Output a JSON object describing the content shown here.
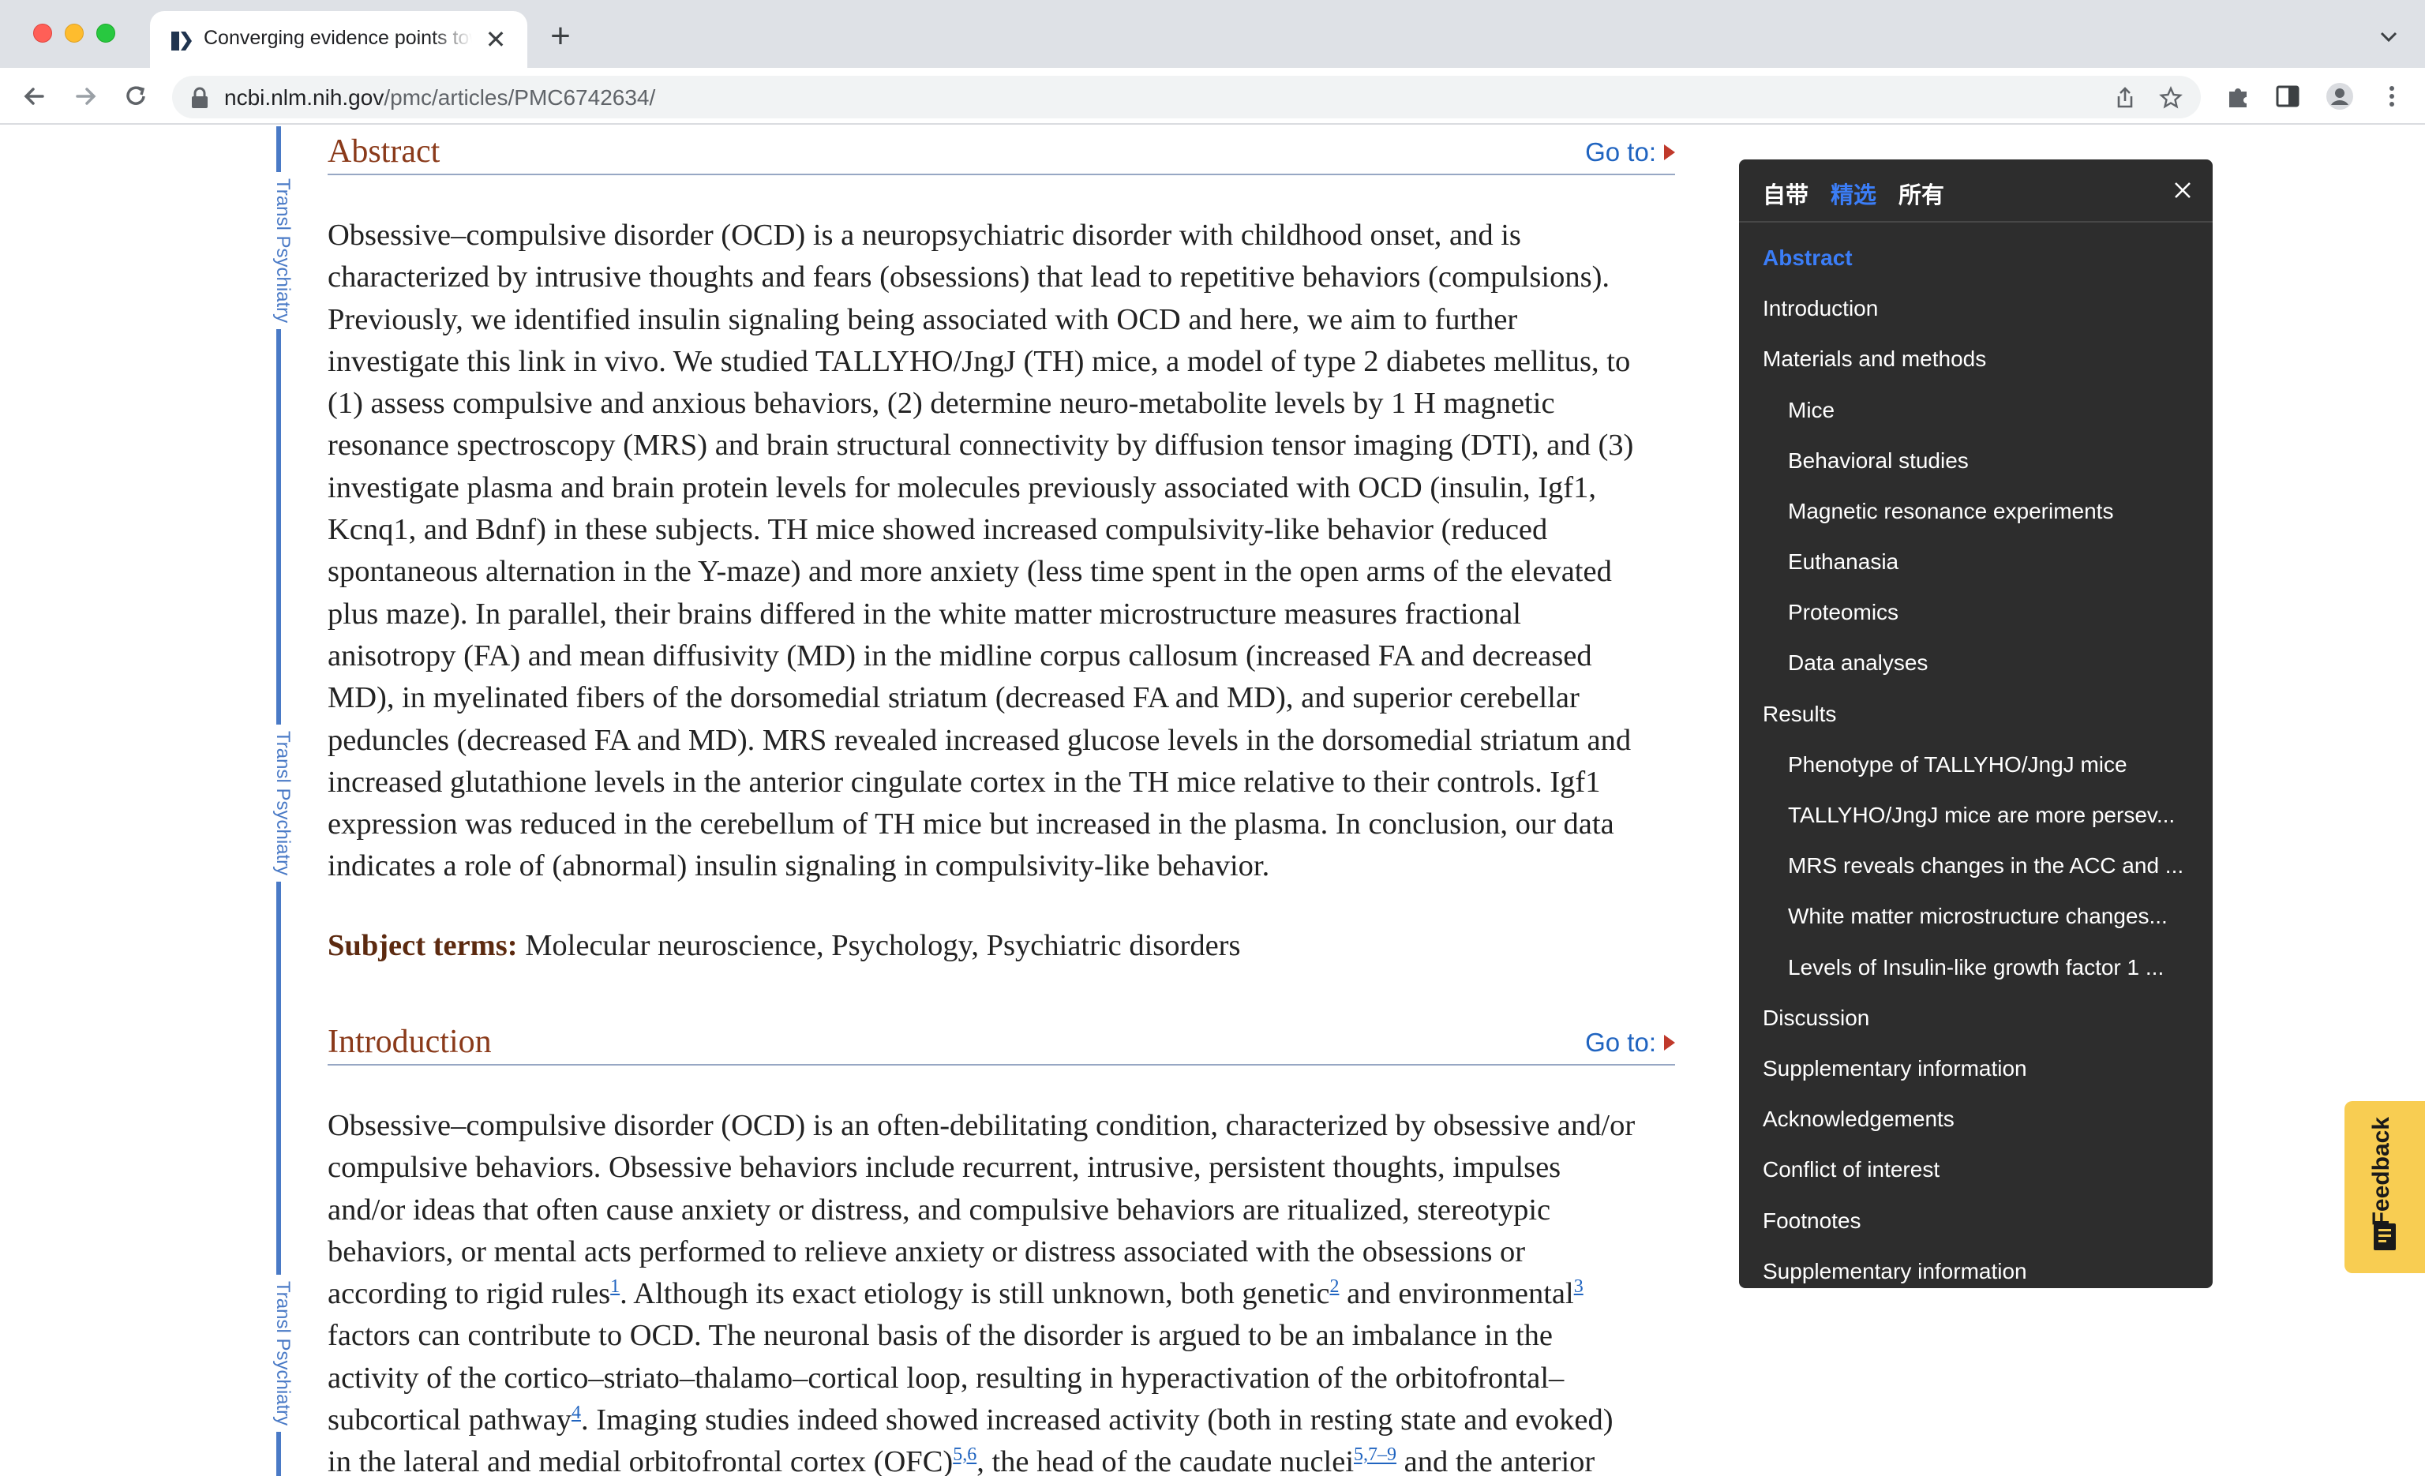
{
  "browser": {
    "tab_title": "Converging evidence points towards a role of insulin signaling",
    "tab_close": "✕",
    "new_tab": "+",
    "url_domain": "ncbi.nlm.nih.gov",
    "url_path": "/pmc/articles/PMC6742634/"
  },
  "page": {
    "journal_label": "Transl Psychiatry",
    "goto_label": "Go to:",
    "abstract": {
      "title": "Abstract",
      "lines": [
        "Obsessive–compulsive disorder (OCD) is a neuropsychiatric disorder with childhood onset, and is",
        "characterized by intrusive thoughts and fears (obsessions) that lead to repetitive behaviors (compulsions).",
        "Previously, we identified insulin signaling being associated with OCD and here, we aim to further",
        "investigate this link in vivo. We studied TALLYHO/JngJ (TH) mice, a model of type 2 diabetes mellitus, to",
        "(1) assess compulsive and anxious behaviors, (2) determine neuro-metabolite levels by 1 H magnetic",
        "resonance spectroscopy (MRS) and brain structural connectivity by diffusion tensor imaging (DTI), and (3)",
        "investigate plasma and brain protein levels for molecules previously associated with OCD (insulin, Igf1,",
        "Kcnq1, and Bdnf) in these subjects. TH mice showed increased compulsivity-like behavior (reduced",
        "spontaneous alternation in the Y-maze) and more anxiety (less time spent in the open arms of the elevated",
        "plus maze). In parallel, their brains differed in the white matter microstructure measures fractional",
        "anisotropy (FA) and mean diffusivity (MD) in the midline corpus callosum (increased FA and decreased",
        "MD), in myelinated fibers of the dorsomedial striatum (decreased FA and MD), and superior cerebellar",
        "peduncles (decreased FA and MD). MRS revealed increased glucose levels in the dorsomedial striatum and",
        "increased glutathione levels in the anterior cingulate cortex in the TH mice relative to their controls. Igf1",
        "expression was reduced in the cerebellum of TH mice but increased in the plasma. In conclusion, our data",
        "indicates a role of (abnormal) insulin signaling in compulsivity-like behavior."
      ]
    },
    "subject_terms_label": "Subject terms:",
    "subject_terms_value": "Molecular neuroscience, Psychology, Psychiatric disorders",
    "introduction": {
      "title": "Introduction",
      "line1": "Obsessive–compulsive disorder (OCD) is an often-debilitating condition, characterized by obsessive and/or",
      "line2": "compulsive behaviors. Obsessive behaviors include recurrent, intrusive, persistent thoughts, impulses",
      "line3": "and/or ideas that often cause anxiety or distress, and compulsive behaviors are ritualized, stereotypic",
      "line4": "behaviors, or mental acts performed to relieve anxiety or distress associated with the obsessions or",
      "line5_a": "according to rigid rules",
      "line5_ref1": "1",
      "line5_b": ". Although its exact etiology is still unknown, both genetic",
      "line5_ref2": "2",
      "line5_c": " and environmental",
      "line5_ref3": "3",
      "line6": "factors can contribute to OCD. The neuronal basis of the disorder is argued to be an imbalance in the",
      "line7": "activity of the cortico–striato–thalamo–cortical loop, resulting in hyperactivation of the orbitofrontal–",
      "line8_a": "subcortical pathway",
      "line8_ref": "4",
      "line8_b": ". Imaging studies indeed showed increased activity (both in resting state and evoked)",
      "line9_a": "in the lateral and medial orbitofrontal cortex (OFC)",
      "line9_ref1": "5,6",
      "line9_b": ", the head of the caudate nuclei",
      "line9_ref2": "5,7–9",
      "line9_c": " and the anterior"
    }
  },
  "outline": {
    "tabs": [
      "自带",
      "精选",
      "所有"
    ],
    "active_tab": "精选",
    "items": [
      {
        "label": "Abstract",
        "level": 1,
        "active": true
      },
      {
        "label": "Introduction",
        "level": 1
      },
      {
        "label": "Materials and methods",
        "level": 1
      },
      {
        "label": "Mice",
        "level": 2
      },
      {
        "label": "Behavioral studies",
        "level": 2
      },
      {
        "label": "Magnetic resonance experiments",
        "level": 2
      },
      {
        "label": "Euthanasia",
        "level": 2
      },
      {
        "label": "Proteomics",
        "level": 2
      },
      {
        "label": "Data analyses",
        "level": 2
      },
      {
        "label": "Results",
        "level": 1
      },
      {
        "label": "Phenotype of TALLYHO/JngJ mice",
        "level": 2
      },
      {
        "label": "TALLYHO/JngJ mice are more persev...",
        "level": 2
      },
      {
        "label": "MRS reveals changes in the ACC and ...",
        "level": 2
      },
      {
        "label": "White matter microstructure changes...",
        "level": 2
      },
      {
        "label": "Levels of Insulin-like growth factor 1 ...",
        "level": 2
      },
      {
        "label": "Discussion",
        "level": 1
      },
      {
        "label": "Supplementary information",
        "level": 1
      },
      {
        "label": "Acknowledgements",
        "level": 1
      },
      {
        "label": "Conflict of interest",
        "level": 1
      },
      {
        "label": "Footnotes",
        "level": 1
      },
      {
        "label": "Supplementary information",
        "level": 1
      }
    ]
  },
  "feedback_label": "Feedback",
  "colors": {
    "accent_blue": "#3b7df6",
    "link_blue": "#2064c0",
    "heading_brown": "#8a3a1a",
    "feedback_yellow": "#f8cd52",
    "panel_bg": "#2d2d2d"
  }
}
